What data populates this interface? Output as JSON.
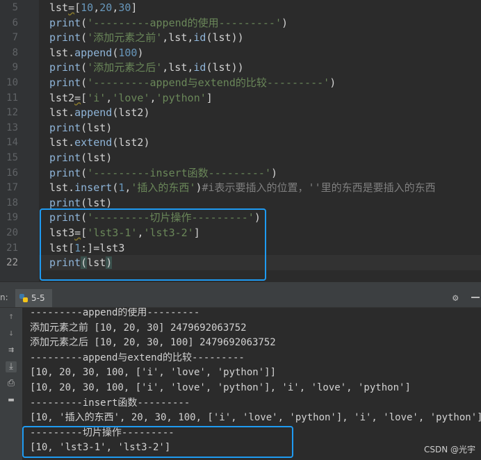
{
  "editor": {
    "lines": [
      {
        "n": "5",
        "tokens": [
          [
            "",
            "lst"
          ],
          [
            "u",
            "="
          ],
          [
            "",
            "["
          ],
          [
            "n",
            "10"
          ],
          [
            "",
            ","
          ],
          [
            "n",
            "20"
          ],
          [
            "",
            ","
          ],
          [
            "n",
            "30"
          ],
          [
            "",
            "]"
          ]
        ]
      },
      {
        "n": "6",
        "tokens": [
          [
            "f",
            "print"
          ],
          [
            "",
            "("
          ],
          [
            "s",
            "'---------append的使用---------'"
          ],
          [
            "",
            ")"
          ]
        ]
      },
      {
        "n": "7",
        "tokens": [
          [
            "f",
            "print"
          ],
          [
            "",
            "("
          ],
          [
            "s",
            "'添加元素之前'"
          ],
          [
            "",
            ","
          ],
          [
            "",
            "lst"
          ],
          [
            "",
            ","
          ],
          [
            "f",
            "id"
          ],
          [
            "",
            "(lst))"
          ]
        ]
      },
      {
        "n": "8",
        "tokens": [
          [
            "",
            "lst."
          ],
          [
            "f",
            "append"
          ],
          [
            "",
            "("
          ],
          [
            "n",
            "100"
          ],
          [
            "",
            ")"
          ]
        ]
      },
      {
        "n": "9",
        "tokens": [
          [
            "f",
            "print"
          ],
          [
            "",
            "("
          ],
          [
            "s",
            "'添加元素之后'"
          ],
          [
            "",
            ","
          ],
          [
            "",
            "lst"
          ],
          [
            "",
            ","
          ],
          [
            "f",
            "id"
          ],
          [
            "",
            "(lst))"
          ]
        ]
      },
      {
        "n": "10",
        "tokens": [
          [
            "f",
            "print"
          ],
          [
            "",
            "("
          ],
          [
            "s",
            "'---------append与extend的比较---------'"
          ],
          [
            "",
            ")"
          ]
        ]
      },
      {
        "n": "11",
        "tokens": [
          [
            "",
            "lst2"
          ],
          [
            "u",
            "="
          ],
          [
            "",
            "["
          ],
          [
            "s",
            "'i'"
          ],
          [
            "",
            ","
          ],
          [
            "s",
            "'love'"
          ],
          [
            "",
            ","
          ],
          [
            "s",
            "'python'"
          ],
          [
            "",
            "]"
          ]
        ]
      },
      {
        "n": "12",
        "tokens": [
          [
            "",
            "lst."
          ],
          [
            "f",
            "append"
          ],
          [
            "",
            "(lst2)"
          ]
        ]
      },
      {
        "n": "13",
        "tokens": [
          [
            "f",
            "print"
          ],
          [
            "",
            "(lst)"
          ]
        ]
      },
      {
        "n": "14",
        "tokens": [
          [
            "",
            "lst."
          ],
          [
            "f",
            "extend"
          ],
          [
            "",
            "(lst2)"
          ]
        ]
      },
      {
        "n": "15",
        "tokens": [
          [
            "f",
            "print"
          ],
          [
            "",
            "(lst)"
          ]
        ]
      },
      {
        "n": "16",
        "tokens": [
          [
            "f",
            "print"
          ],
          [
            "",
            "("
          ],
          [
            "s",
            "'---------insert函数---------'"
          ],
          [
            "",
            ")"
          ]
        ]
      },
      {
        "n": "17",
        "tokens": [
          [
            "",
            "lst."
          ],
          [
            "f",
            "insert"
          ],
          [
            "",
            "("
          ],
          [
            "n",
            "1"
          ],
          [
            "",
            ","
          ],
          [
            "s",
            "'插入的东西'"
          ],
          [
            "",
            ")"
          ],
          [
            "cm",
            "#i表示要插入的位置，''里的东西是要插入的东西"
          ]
        ]
      },
      {
        "n": "18",
        "tokens": [
          [
            "f",
            "print"
          ],
          [
            "",
            "(lst)"
          ]
        ]
      },
      {
        "n": "19",
        "tokens": [
          [
            "f",
            "print"
          ],
          [
            "",
            "("
          ],
          [
            "s",
            "'---------切片操作---------'"
          ],
          [
            "",
            ")"
          ]
        ]
      },
      {
        "n": "20",
        "tokens": [
          [
            "",
            "lst3"
          ],
          [
            "u",
            "="
          ],
          [
            "",
            "["
          ],
          [
            "s",
            "'lst3-1'"
          ],
          [
            "",
            ","
          ],
          [
            "s",
            "'lst3-2'"
          ],
          [
            "",
            "]"
          ]
        ]
      },
      {
        "n": "21",
        "tokens": [
          [
            "",
            "lst["
          ],
          [
            "n",
            "1"
          ],
          [
            "",
            ":]="
          ],
          [
            "",
            "lst3"
          ]
        ]
      },
      {
        "n": "22",
        "tokens": [
          [
            "f",
            "print"
          ],
          [
            "br",
            "("
          ],
          [
            "",
            "lst"
          ],
          [
            "br",
            ")"
          ]
        ]
      }
    ]
  },
  "run_panel": {
    "label": "n:",
    "tab_name": "5-5"
  },
  "console": {
    "lines": [
      "---------append的使用---------",
      "添加元素之前 [10, 20, 30] 2479692063752",
      "添加元素之后 [10, 20, 30, 100] 2479692063752",
      "---------append与extend的比较---------",
      "[10, 20, 30, 100, ['i', 'love', 'python']]",
      "[10, 20, 30, 100, ['i', 'love', 'python'], 'i', 'love', 'python']",
      "---------insert函数---------",
      "[10, '插入的东西', 20, 30, 100, ['i', 'love', 'python'], 'i', 'love', 'python']",
      "---------切片操作---------",
      "[10, 'lst3-1', 'lst3-2']"
    ]
  },
  "watermark": "CSDN @光宇",
  "colors": {
    "function": "#8fb5d9",
    "string": "#6a8759",
    "number": "#6897bb",
    "comment": "#7f7f7f",
    "highlight": "#1e9bf2"
  },
  "icons": [
    "python-file-icon",
    "gear-icon",
    "minimize-icon",
    "arrow-up-icon",
    "arrow-down-icon",
    "soft-wrap-icon",
    "scroll-to-end-icon",
    "print-icon",
    "trash-icon"
  ]
}
